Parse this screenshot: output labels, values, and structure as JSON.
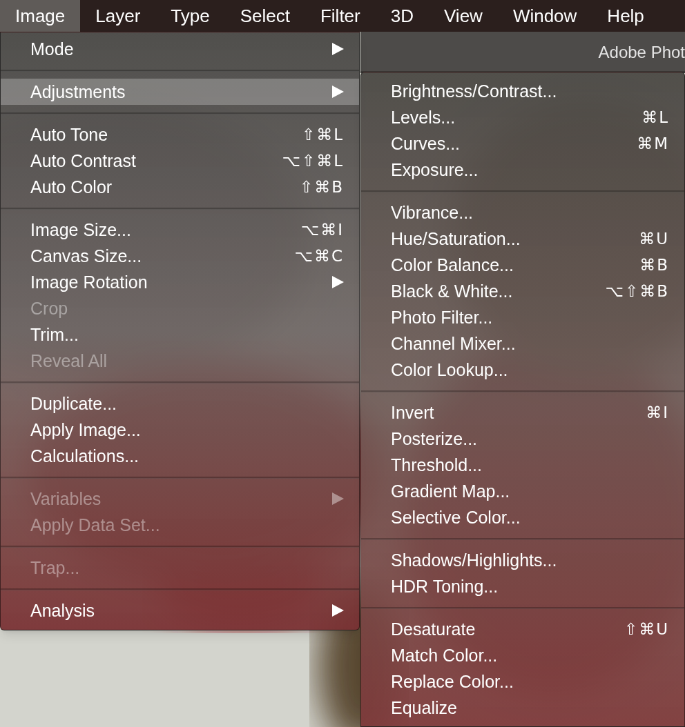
{
  "menubar": [
    {
      "label": "Image",
      "selected": true
    },
    {
      "label": "Layer",
      "selected": false
    },
    {
      "label": "Type",
      "selected": false
    },
    {
      "label": "Select",
      "selected": false
    },
    {
      "label": "Filter",
      "selected": false
    },
    {
      "label": "3D",
      "selected": false
    },
    {
      "label": "View",
      "selected": false
    },
    {
      "label": "Window",
      "selected": false
    },
    {
      "label": "Help",
      "selected": false
    }
  ],
  "window_title": "Adobe Phot",
  "image_menu": {
    "sections": [
      [
        {
          "label": "Mode",
          "has_submenu": true,
          "disabled": false,
          "selected": false
        }
      ],
      [
        {
          "label": "Adjustments",
          "has_submenu": true,
          "disabled": false,
          "selected": true
        }
      ],
      [
        {
          "label": "Auto Tone",
          "shortcut": "⇧⌘L",
          "disabled": false,
          "selected": false
        },
        {
          "label": "Auto Contrast",
          "shortcut": "⌥⇧⌘L",
          "disabled": false,
          "selected": false
        },
        {
          "label": "Auto Color",
          "shortcut": "⇧⌘B",
          "disabled": false,
          "selected": false
        }
      ],
      [
        {
          "label": "Image Size...",
          "shortcut": "⌥⌘I",
          "disabled": false,
          "selected": false
        },
        {
          "label": "Canvas Size...",
          "shortcut": "⌥⌘C",
          "disabled": false,
          "selected": false
        },
        {
          "label": "Image Rotation",
          "has_submenu": true,
          "disabled": false,
          "selected": false
        },
        {
          "label": "Crop",
          "disabled": true,
          "selected": false
        },
        {
          "label": "Trim...",
          "disabled": false,
          "selected": false
        },
        {
          "label": "Reveal All",
          "disabled": true,
          "selected": false
        }
      ],
      [
        {
          "label": "Duplicate...",
          "disabled": false,
          "selected": false
        },
        {
          "label": "Apply Image...",
          "disabled": false,
          "selected": false
        },
        {
          "label": "Calculations...",
          "disabled": false,
          "selected": false
        }
      ],
      [
        {
          "label": "Variables",
          "has_submenu": true,
          "disabled": true,
          "selected": false
        },
        {
          "label": "Apply Data Set...",
          "disabled": true,
          "selected": false
        }
      ],
      [
        {
          "label": "Trap...",
          "disabled": true,
          "selected": false
        }
      ],
      [
        {
          "label": "Analysis",
          "has_submenu": true,
          "disabled": false,
          "selected": false
        }
      ]
    ]
  },
  "adjustments_submenu": {
    "sections": [
      [
        {
          "label": "Brightness/Contrast...",
          "disabled": false,
          "selected": false
        },
        {
          "label": "Levels...",
          "shortcut": "⌘L",
          "disabled": false,
          "selected": false
        },
        {
          "label": "Curves...",
          "shortcut": "⌘M",
          "disabled": false,
          "selected": false
        },
        {
          "label": "Exposure...",
          "disabled": false,
          "selected": false
        }
      ],
      [
        {
          "label": "Vibrance...",
          "disabled": false,
          "selected": false
        },
        {
          "label": "Hue/Saturation...",
          "shortcut": "⌘U",
          "disabled": false,
          "selected": false
        },
        {
          "label": "Color Balance...",
          "shortcut": "⌘B",
          "disabled": false,
          "selected": false
        },
        {
          "label": "Black & White...",
          "shortcut": "⌥⇧⌘B",
          "disabled": false,
          "selected": false
        },
        {
          "label": "Photo Filter...",
          "disabled": false,
          "selected": false
        },
        {
          "label": "Channel Mixer...",
          "disabled": false,
          "selected": false
        },
        {
          "label": "Color Lookup...",
          "disabled": false,
          "selected": false
        }
      ],
      [
        {
          "label": "Invert",
          "shortcut": "⌘I",
          "disabled": false,
          "selected": false
        },
        {
          "label": "Posterize...",
          "disabled": false,
          "selected": false
        },
        {
          "label": "Threshold...",
          "disabled": false,
          "selected": false
        },
        {
          "label": "Gradient Map...",
          "disabled": false,
          "selected": false
        },
        {
          "label": "Selective Color...",
          "disabled": false,
          "selected": false
        }
      ],
      [
        {
          "label": "Shadows/Highlights...",
          "disabled": false,
          "selected": false
        },
        {
          "label": "HDR Toning...",
          "disabled": false,
          "selected": false
        }
      ],
      [
        {
          "label": "Desaturate",
          "shortcut": "⇧⌘U",
          "disabled": false,
          "selected": false
        },
        {
          "label": "Match Color...",
          "disabled": false,
          "selected": false
        },
        {
          "label": "Replace Color...",
          "disabled": false,
          "selected": false
        },
        {
          "label": "Equalize",
          "disabled": false,
          "selected": false
        }
      ]
    ]
  }
}
